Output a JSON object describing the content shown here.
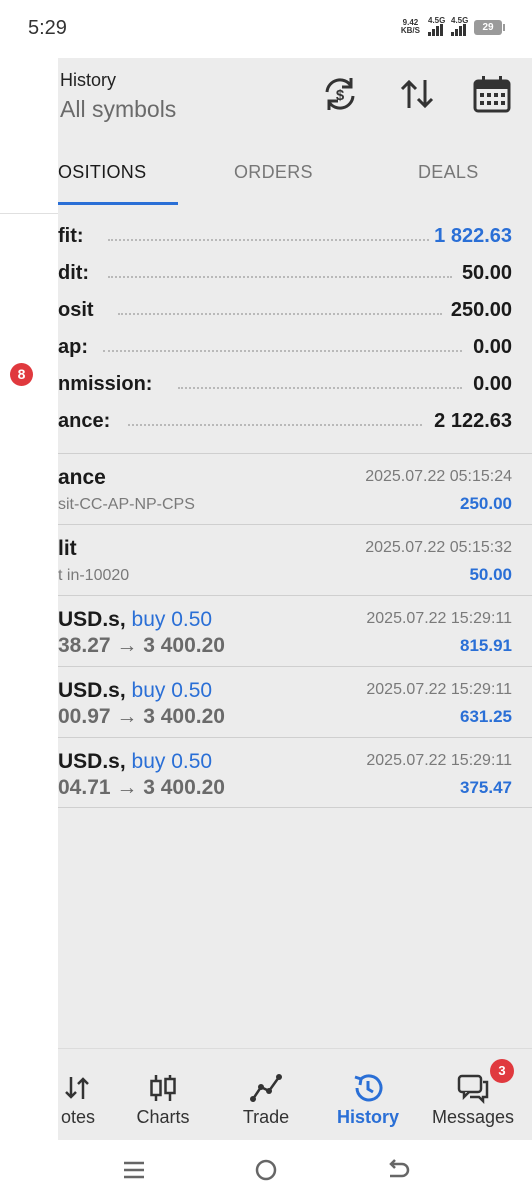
{
  "status_bar": {
    "time": "5:29",
    "net_speed_value": "9.42",
    "net_speed_unit": "KB/S",
    "signal1_label": "4.5G",
    "signal2_label": "4.5G",
    "battery": "29"
  },
  "drawer": {
    "badge": "8"
  },
  "header": {
    "title": "History",
    "subtitle": "All symbols"
  },
  "tabs": [
    {
      "label": "OSITIONS",
      "active": true
    },
    {
      "label": "ORDERS",
      "active": false
    },
    {
      "label": "DEALS",
      "active": false
    }
  ],
  "summary": [
    {
      "label": "fit:",
      "value": "1 822.63",
      "highlight": true
    },
    {
      "label": "dit:",
      "value": "50.00",
      "highlight": false
    },
    {
      "label": "osit",
      "value": "250.00",
      "highlight": false
    },
    {
      "label": "ap:",
      "value": "0.00",
      "highlight": false
    },
    {
      "label": "nmission:",
      "value": "0.00",
      "highlight": false
    },
    {
      "label": "ance:",
      "value": "2 122.63",
      "highlight": false
    }
  ],
  "deals": [
    {
      "title": "ance",
      "side": "",
      "subtitle": "sit-CC-AP-NP-CPS",
      "prices": "",
      "time": "2025.07.22 05:15:24",
      "amount": "250.00"
    },
    {
      "title": "lit",
      "side": "",
      "subtitle": "t in-10020",
      "prices": "",
      "time": "2025.07.22 05:15:32",
      "amount": "50.00"
    },
    {
      "title": "USD.s,",
      "side": "buy 0.50",
      "subtitle": "",
      "prices": "38.27 → 3 400.20",
      "time": "2025.07.22 15:29:11",
      "amount": "815.91"
    },
    {
      "title": "USD.s,",
      "side": "buy 0.50",
      "subtitle": "",
      "prices": "00.97 → 3 400.20",
      "time": "2025.07.22 15:29:11",
      "amount": "631.25"
    },
    {
      "title": "USD.s,",
      "side": "buy 0.50",
      "subtitle": "",
      "prices": "04.71 → 3 400.20",
      "time": "2025.07.22 15:29:11",
      "amount": "375.47"
    }
  ],
  "bottom_nav": [
    {
      "label": "otes",
      "icon": "quotes-arrows-icon",
      "active": false
    },
    {
      "label": "Charts",
      "icon": "candlestick-icon",
      "active": false
    },
    {
      "label": "Trade",
      "icon": "trade-line-icon",
      "active": false
    },
    {
      "label": "History",
      "icon": "history-clock-icon",
      "active": true
    },
    {
      "label": "Messages",
      "icon": "messages-icon",
      "active": false,
      "badge": "3"
    }
  ],
  "colors": {
    "accent": "#2a6fd6",
    "badge": "#e0393e",
    "panel_bg": "#ececec"
  }
}
